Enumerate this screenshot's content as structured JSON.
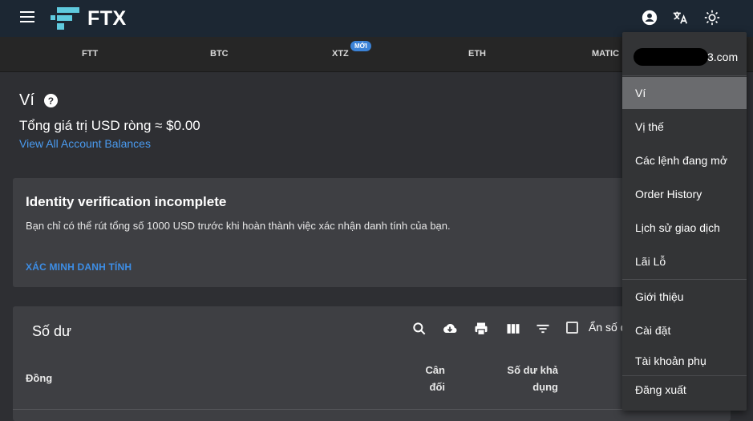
{
  "header": {
    "logo_text": "FTX",
    "icons": [
      "menu-icon",
      "account-icon",
      "translate-icon",
      "theme-icon"
    ],
    "accent": "#1c2733"
  },
  "market_strip": {
    "items": [
      {
        "label": "FTT"
      },
      {
        "label": "BTC"
      },
      {
        "label": "XTZ",
        "badge": "MỚI"
      },
      {
        "label": "ETH"
      },
      {
        "label": "MATIC"
      }
    ]
  },
  "wallet": {
    "title": "Ví",
    "net_usd": "Tổng giá trị USD ròng ≈ $0.00",
    "view_all": "View All Account Balances"
  },
  "identity": {
    "title": "Identity verification incomplete",
    "description": "Bạn chỉ có thể rút tổng số 1000 USD trước khi hoàn thành việc xác nhận danh tính của bạn.",
    "link": "XÁC MINH DANH TÍNH"
  },
  "balances": {
    "title": "Số dư",
    "hide_label": "Ẩn số dư",
    "toolbar_icons": [
      "search-icon",
      "cloud-download-icon",
      "print-icon",
      "columns-icon",
      "filter-icon"
    ],
    "columns": [
      {
        "line1": "Đồng",
        "line2": ""
      },
      {
        "line1": "Cân",
        "line2": "đối"
      },
      {
        "line1": "Số dư khả",
        "line2": "dụng"
      }
    ]
  },
  "account_menu": {
    "email_suffix": "3.com",
    "items": [
      "Ví",
      "Vị thế",
      "Các lệnh đang mở",
      "Order History",
      "Lịch sử giao dịch",
      "Lãi Lỗ",
      "Giới thiệu",
      "Cài đặt",
      "Tài khoản phụ",
      "Đăng xuất"
    ],
    "active_item": "Ví"
  }
}
